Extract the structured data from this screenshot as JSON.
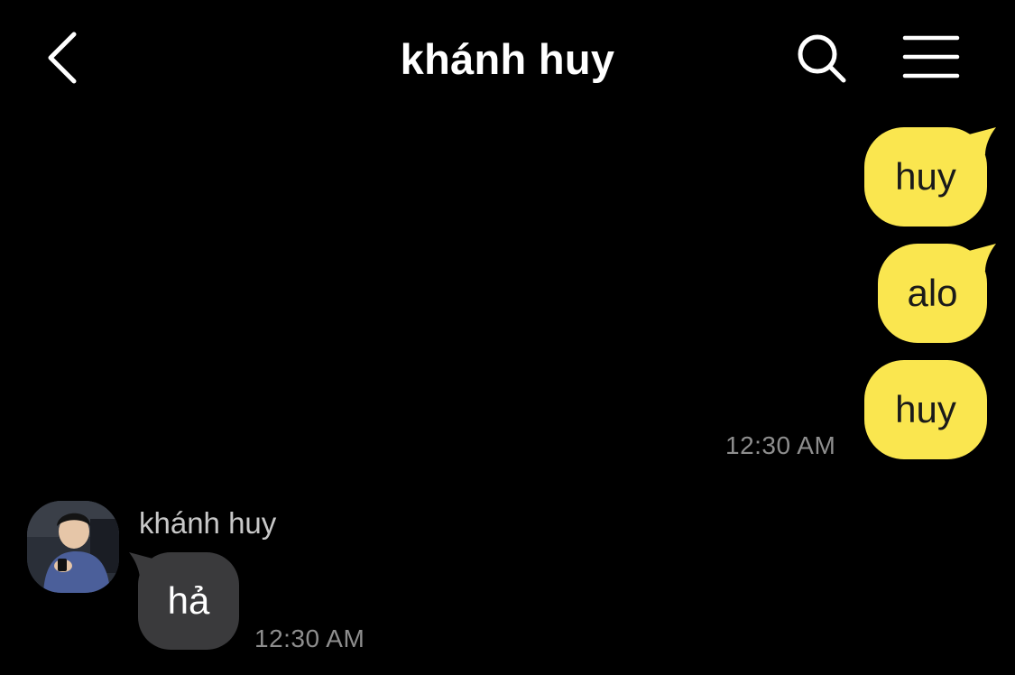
{
  "header": {
    "title": "khánh huy",
    "back_icon": "chevron-left-icon",
    "search_icon": "search-icon",
    "menu_icon": "hamburger-menu-icon"
  },
  "messages_outgoing": [
    {
      "text": "huy"
    },
    {
      "text": "alo"
    },
    {
      "text": "huy"
    }
  ],
  "outgoing_time": "12:30 AM",
  "incoming": {
    "sender": "khánh huy",
    "text": "hả",
    "time": "12:30 AM"
  },
  "colors": {
    "background": "#000000",
    "outgoing_bubble": "#fae64f",
    "incoming_bubble": "#3a3a3c",
    "timestamp": "#8e8e8e"
  }
}
